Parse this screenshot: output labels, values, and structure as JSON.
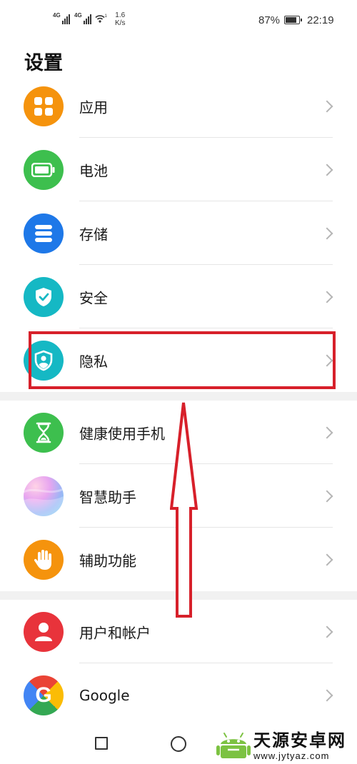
{
  "status_bar": {
    "signal1_tag": "4G",
    "signal2_tag": "4G",
    "hotspot_sub": "1",
    "net_speed_value": "1.6",
    "net_speed_unit": "K/s",
    "battery_percent": "87%",
    "battery_level": 0.87,
    "time": "22:19"
  },
  "page": {
    "title": "设置"
  },
  "groups": [
    {
      "items": [
        {
          "label": "应用",
          "icon": "apps-icon",
          "color": "#F5930D"
        },
        {
          "label": "电池",
          "icon": "battery-icon",
          "color": "#3DBF4E"
        },
        {
          "label": "存储",
          "icon": "storage-icon",
          "color": "#1E78E8"
        },
        {
          "label": "安全",
          "icon": "shield-check-icon",
          "color": "#15B8C4"
        },
        {
          "label": "隐私",
          "icon": "privacy-icon",
          "color": "#15B8C4"
        }
      ]
    },
    {
      "items": [
        {
          "label": "健康使用手机",
          "icon": "hourglass-icon",
          "color": "#3DBF4E"
        },
        {
          "label": "智慧助手",
          "icon": "assistant-icon",
          "color": "#B58CF0"
        },
        {
          "label": "辅助功能",
          "icon": "hand-icon",
          "color": "#F5930D"
        }
      ]
    },
    {
      "items": [
        {
          "label": "用户和帐户",
          "icon": "user-icon",
          "color": "#E8333B"
        },
        {
          "label": "Google",
          "icon": "google-icon",
          "color": "#4285F4"
        }
      ]
    }
  ],
  "annotation": {
    "color": "#D7202A"
  },
  "watermark": {
    "title": "天源安卓网",
    "url": "www.jytyaz.com"
  }
}
